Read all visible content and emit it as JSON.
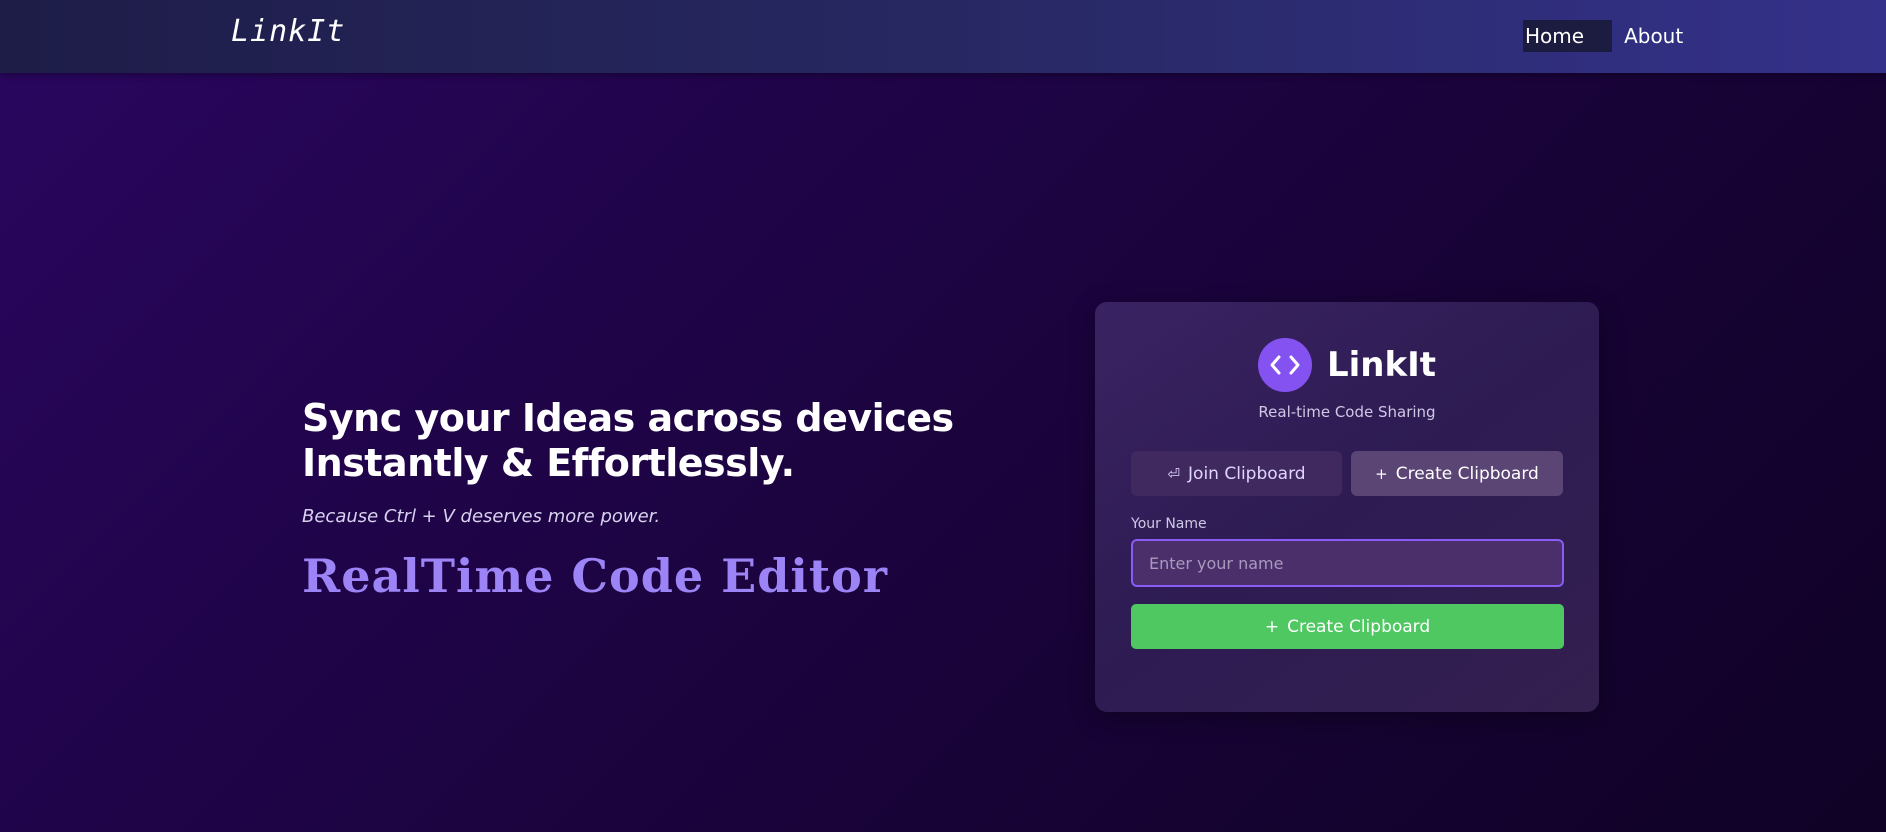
{
  "navbar": {
    "brand": "LinkIt",
    "links": [
      "Home",
      "About"
    ]
  },
  "hero": {
    "title_line1": "Sync your Ideas across devices",
    "title_line2": "Instantly & Effortlessly.",
    "subtitle": "Because Ctrl + V deserves more power.",
    "script_text": "RealTime Code Editor"
  },
  "card": {
    "logo_icon": "code-brackets-icon",
    "title": "LinkIt",
    "subtitle": "Real-time Code Sharing",
    "tabs": [
      {
        "icon": "⏎",
        "label": "Join Clipboard",
        "active": false
      },
      {
        "icon": "+",
        "label": "Create Clipboard",
        "active": true
      }
    ],
    "name_label": "Your Name",
    "name_value": "",
    "name_placeholder": "Enter your name",
    "submit_icon": "+",
    "submit_label": "Create Clipboard"
  },
  "colors": {
    "accent": "#8552f2",
    "script": "#9d84f6",
    "submit": "#4fc862"
  }
}
